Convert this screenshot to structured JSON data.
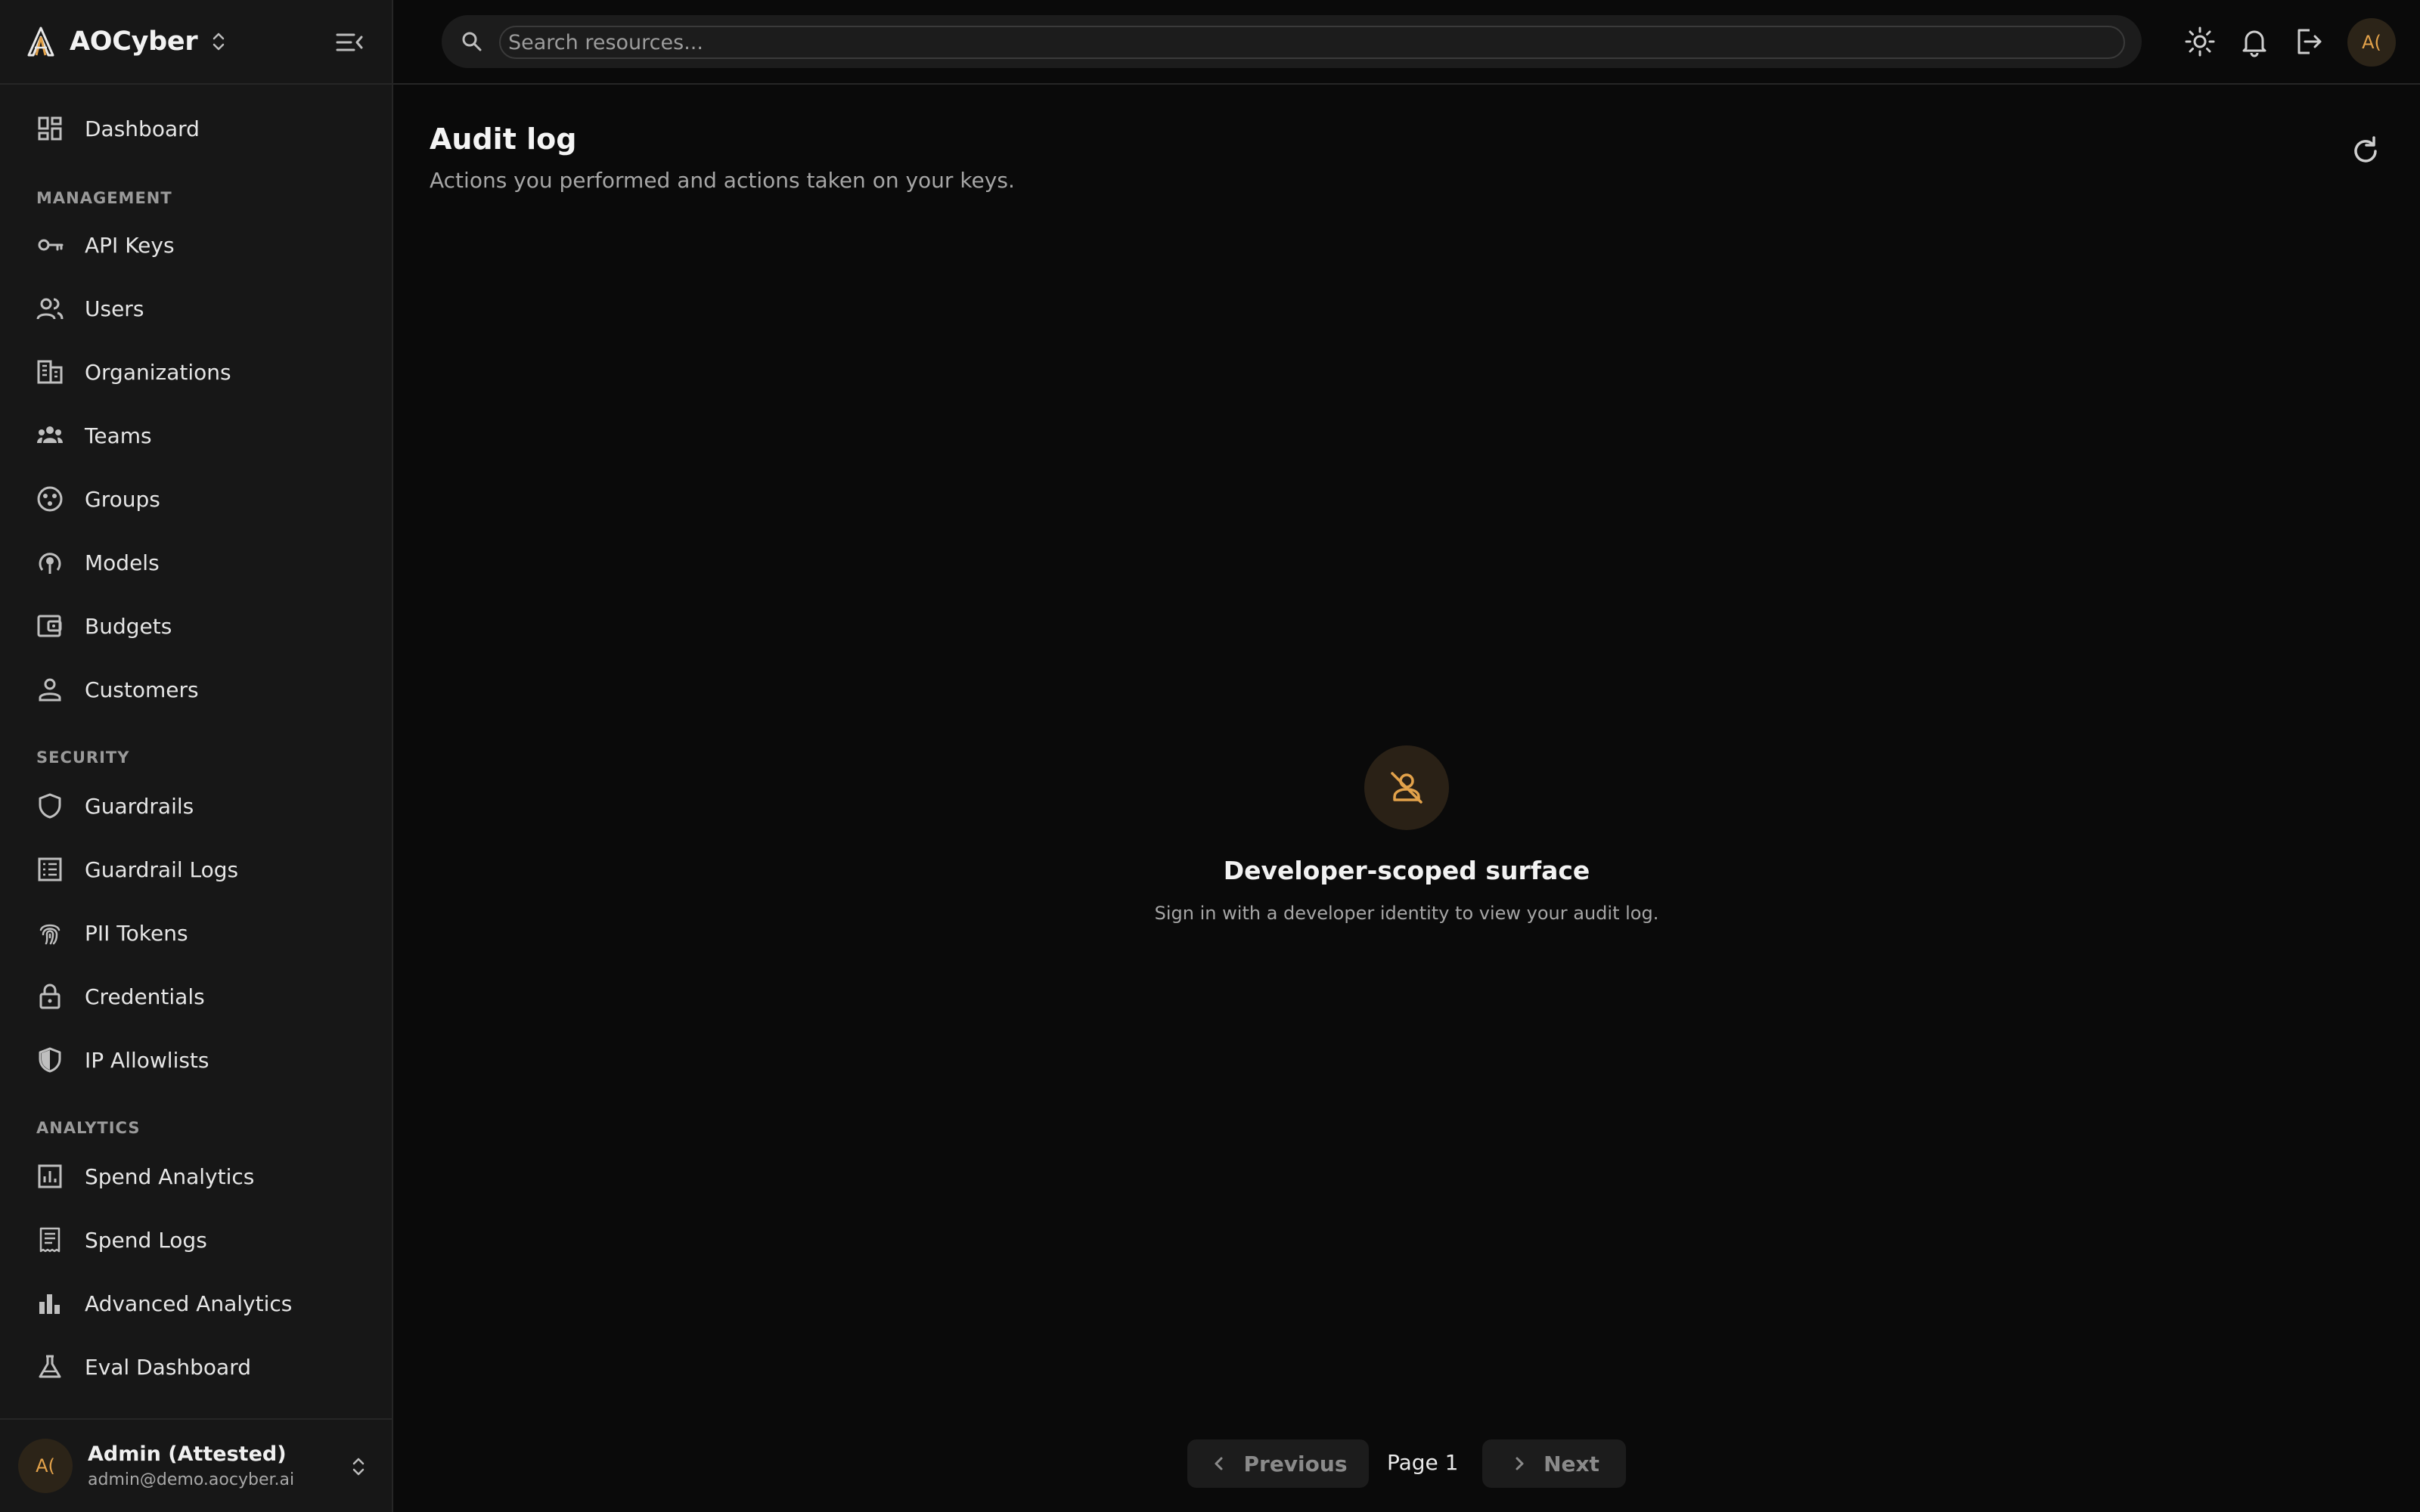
{
  "brand": {
    "name": "AOCyber"
  },
  "search": {
    "placeholder": "Search resources..."
  },
  "topbar": {
    "avatar_initials": "A("
  },
  "sidebar": {
    "dashboard": {
      "label": "Dashboard",
      "icon": "dashboard-icon"
    },
    "sections": {
      "management": "MANAGEMENT",
      "security": "SECURITY",
      "analytics": "ANALYTICS"
    },
    "management_items": [
      {
        "label": "API Keys",
        "icon": "key-icon"
      },
      {
        "label": "Users",
        "icon": "users-icon"
      },
      {
        "label": "Organizations",
        "icon": "building-icon"
      },
      {
        "label": "Teams",
        "icon": "team-icon"
      },
      {
        "label": "Groups",
        "icon": "groups-icon"
      },
      {
        "label": "Models",
        "icon": "model-icon"
      },
      {
        "label": "Budgets",
        "icon": "wallet-icon"
      },
      {
        "label": "Customers",
        "icon": "person-icon"
      }
    ],
    "security_items": [
      {
        "label": "Guardrails",
        "icon": "shield-icon"
      },
      {
        "label": "Guardrail Logs",
        "icon": "log-list-icon"
      },
      {
        "label": "PII Tokens",
        "icon": "fingerprint-icon"
      },
      {
        "label": "Credentials",
        "icon": "lock-icon"
      },
      {
        "label": "IP Allowlists",
        "icon": "shield-half-icon"
      }
    ],
    "analytics_items": [
      {
        "label": "Spend Analytics",
        "icon": "chart-box-icon"
      },
      {
        "label": "Spend Logs",
        "icon": "receipt-icon"
      },
      {
        "label": "Advanced Analytics",
        "icon": "bar-chart-icon"
      },
      {
        "label": "Eval Dashboard",
        "icon": "flask-icon"
      }
    ]
  },
  "user": {
    "initials": "A(",
    "name": "Admin (Attested)",
    "email": "admin@demo.aocyber.ai"
  },
  "page": {
    "title": "Audit log",
    "subtitle": "Actions you performed and actions taken on your keys."
  },
  "empty_state": {
    "icon": "person-off-icon",
    "title": "Developer-scoped surface",
    "message": "Sign in with a developer identity to view your audit log."
  },
  "pagination": {
    "previous": "Previous",
    "page": "Page 1",
    "next": "Next"
  },
  "colors": {
    "background": "#0a0a0a",
    "sidebar": "#171717",
    "accent": "#e3a24a"
  }
}
